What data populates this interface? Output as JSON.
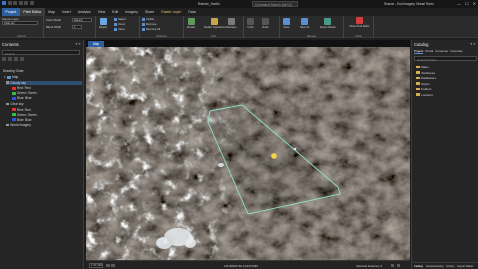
{
  "window": {
    "project_name": "Rainier_Hartin",
    "search_placeholder": "Command Search (Alt+Q)",
    "user": "Sharon - Esri Imagery Virtual Team",
    "minimize": "—",
    "maximize": "☐",
    "close": "✕"
  },
  "ribbon_tabs": [
    "Project",
    "Pixel Editor",
    "Map",
    "Insert",
    "Analysis",
    "View",
    "Edit",
    "Imagery",
    "Share",
    "Raster Layer",
    "Data"
  ],
  "ribbon": {
    "source_layer_label": "Source Layer",
    "source_layer_value": "Clear sky",
    "color_model_label": "Color Model",
    "color_model_value": "Natural",
    "blend_width_label": "Blend Width",
    "blend_width_value": "1",
    "groups": {
      "options": "Options",
      "edit": "Edit",
      "selection": "Selection",
      "manage": "Manage",
      "close": "Close"
    },
    "buttons": {
      "region": "Region",
      "select": "Select",
      "visible": "Visible",
      "zoom": "Zoom",
      "remove": "Remove",
      "clear": "Clear",
      "remove_all": "Remove All",
      "mosaic": "Mosaic",
      "reshape": "Reshape",
      "redact_operations": "Redact Operations",
      "undo": "Undo",
      "redo": "Redo",
      "operations": "Operations",
      "save": "Save",
      "save_as": "Save As",
      "export": "Export Raster",
      "close_editor": "Close Pixel Editor"
    }
  },
  "contents": {
    "title": "Contents",
    "search_placeholder": "Search",
    "drawing_order": "Drawing Order",
    "map_name": "Map",
    "layers": [
      {
        "name": "Cloudy sky",
        "bands": [
          "Red: Red",
          "Green: Green",
          "Blue: Blue"
        ]
      },
      {
        "name": "Clear sky",
        "bands": [
          "Red: Red",
          "Green: Green",
          "Blue: Blue"
        ]
      }
    ],
    "basemap": "World Imagery"
  },
  "map": {
    "tab": "Map",
    "scale": "1:47,216",
    "coordinates": "146.9930274E 6.0137346S",
    "selected_features": "Selected Features: 0"
  },
  "catalog": {
    "title": "Catalog",
    "tabs": [
      "Project",
      "Portal",
      "Computer",
      "Favorites"
    ],
    "search_placeholder": "Search Project",
    "items": [
      "Maps",
      "Toolboxes",
      "Databases",
      "Styles",
      "Folders",
      "Locators"
    ],
    "bottom_tabs": [
      "Catalog",
      "Geoprocessing",
      "History",
      "Export Raster"
    ]
  },
  "colors": {
    "accent": "#2d5ea0",
    "polygon_outline": "#8fe0c8",
    "point_marker": "#f2d44a",
    "folder": "#d6b04e"
  }
}
